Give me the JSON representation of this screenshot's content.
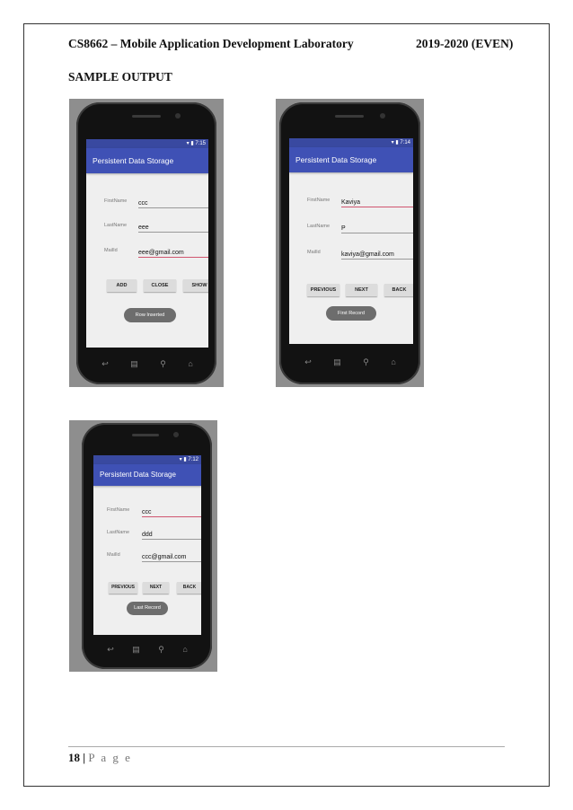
{
  "document": {
    "header_left": "CS8662 – Mobile Application Development Laboratory",
    "header_right": "2019-2020 (EVEN)",
    "section_title": "SAMPLE OUTPUT",
    "footer_page_number": "18",
    "footer_separator": " | ",
    "footer_page_label": "P a g e"
  },
  "screenshots": [
    {
      "time": "7:15",
      "app_title": "Persistent Data Storage",
      "fields": [
        {
          "label": "FirstName",
          "value": "ccc"
        },
        {
          "label": "LastName",
          "value": "eee"
        },
        {
          "label": "MailId",
          "value": "eee@gmail.com"
        }
      ],
      "buttons": [
        "ADD",
        "CLOSE",
        "SHOW"
      ],
      "toast": "Row Inserted"
    },
    {
      "time": "7:14",
      "app_title": "Persistent Data Storage",
      "fields": [
        {
          "label": "FirstName",
          "value": "Kaviya"
        },
        {
          "label": "LastName",
          "value": "P"
        },
        {
          "label": "MailId",
          "value": "kaviya@gmail.com"
        }
      ],
      "buttons": [
        "PREVIOUS",
        "NEXT",
        "BACK"
      ],
      "toast": "First Record"
    },
    {
      "time": "7:12",
      "app_title": "Persistent Data Storage",
      "fields": [
        {
          "label": "FirstName",
          "value": "ccc"
        },
        {
          "label": "LastName",
          "value": "ddd"
        },
        {
          "label": "MailId",
          "value": "ccc@gmail.com"
        }
      ],
      "buttons": [
        "PREVIOUS",
        "NEXT",
        "BACK"
      ],
      "toast": "Last Record"
    }
  ],
  "icons": {
    "status": "wifi-battery-icon",
    "nav": [
      "back-icon",
      "menu-icon",
      "search-icon",
      "home-icon"
    ]
  }
}
